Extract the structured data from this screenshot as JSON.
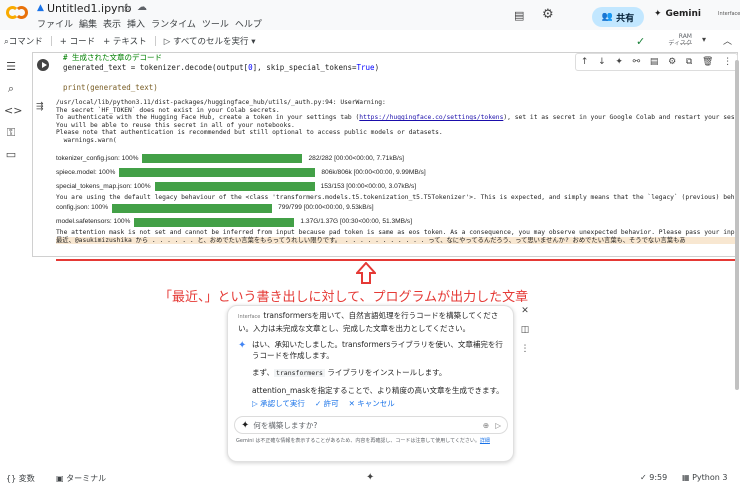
{
  "titlebar": {
    "title": "Untitled1.ipynb",
    "menus": [
      "ファイル",
      "編集",
      "表示",
      "挿入",
      "ランタイム",
      "ツール",
      "ヘルプ"
    ],
    "share_label": "共有",
    "gemini_label": "Gemini",
    "avatar_label": "Interface"
  },
  "toolbar": {
    "commands": "コマンド",
    "add_code": "+ コード",
    "add_text": "+ テキスト",
    "run_all": "すべてのセルを実行",
    "ram": "RAM",
    "disk": "ディスク"
  },
  "cell": {
    "code_comment": "# 生成された文章のデコード",
    "code_line2_a": "generated_text = tokenizer.decode(output[",
    "code_line2_idx": "0",
    "code_line2_b": "], skip_special_tokens=",
    "code_line2_true": "True",
    "code_line2_c": ")",
    "code_line3": "print(generated_text)",
    "output_warn": [
      "/usr/local/lib/python3.11/dist-packages/huggingface_hub/utils/_auth.py:94: UserWarning:",
      "The secret `HF_TOKEN` does not exist in your Colab secrets.",
      "To authenticate with the Hugging Face Hub, create a token in your settings tab (https://huggingface.co/settings/tokens), set it as secret in your Google Colab and restart your session.",
      "You will be able to reuse this secret in all of your notebooks.",
      "Please note that authentication is recommended but still optional to access public models or datasets.",
      "  warnings.warn("
    ],
    "downloads": [
      {
        "name": "tokenizer_config.json: 100%",
        "info": "282/282 [00:00<00:00, 7.71kB/s]",
        "fill": 1.0
      },
      {
        "name": "spiece.model: 100%",
        "info": "806k/806k [00:00<00:00, 9.99MB/s]",
        "fill": 1.0
      },
      {
        "name": "special_tokens_map.json: 100%",
        "info": "153/153 [00:00<00:00, 3.07kB/s]",
        "fill": 1.0
      }
    ],
    "legacy_line": "You are using the default legacy behaviour of the <class 'transformers.models.t5.tokenization_t5.T5Tokenizer'>. This is expected, and simply means that the `legacy` (previous) behavior w",
    "downloads2": [
      {
        "name": "config.json: 100%",
        "info": "799/799 [00:00<00:00, 9.53kB/s]",
        "fill": 1.0
      },
      {
        "name": "model.safetensors: 100%",
        "info": "1.37G/1.37G [00:30<00:00, 51.3MB/s]",
        "fill": 1.0
      }
    ],
    "attention_line": "The attention mask is not set and cannot be inferred from input because pad token is same as eos token. As a consequence, you may observe unexpected behavior. Please pass your input's `a",
    "generated_line": "最近、@asukimizushika から . . . . . . と、おめでたい言葉をもらってうれしい限りです。 . . . . . . . . . . . って、なにやってるんだろう、って思いませんか? おめでたい言葉も、そうでない言葉もあ"
  },
  "caption": "「最近、」という書き出しに対して、プログラムが出力した文章",
  "gemini": {
    "user_tag": "Interface",
    "user_msg": "transformersを用いて、自然言語処理を行うコードを構築してください。入力は未完成な文章とし、完成した文章を出力としてください。",
    "reply1": "はい、承知いたしました。transformersライブラリを使い、文章補完を行うコードを作成します。",
    "reply2_a": "まず、",
    "reply2_code": "transformers",
    "reply2_b": " ライブラリをインストールします。",
    "reply3": "attention_maskを指定することで、より精度の高い文章を生成できます。",
    "action_run": "▷ 承認して実行",
    "action_allow": "✓ 許可",
    "action_cancel": "✕ キャンセル",
    "input_placeholder": "何を構築しますか?",
    "disclaimer": "Gemini は不正確な情報を表示することがあるため、内容を再確認し、コードは注意して使用してください。",
    "disclaimer_link": "詳細"
  },
  "statusbar": {
    "vars": "{} 変数",
    "terminal": "ターミナル",
    "time": "✓ 9:59",
    "python": "Python 3"
  },
  "colors": {
    "progress": "#43a047",
    "accent_red": "#e53935",
    "share_bg": "#c2e7ff"
  }
}
